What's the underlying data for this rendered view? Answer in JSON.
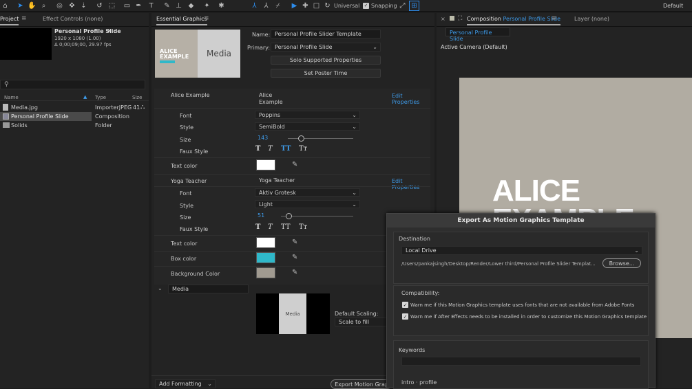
{
  "toolbar": {
    "universal": "Universal",
    "snapping": "Snapping",
    "workspace": "Default"
  },
  "project": {
    "tab_project": "Project",
    "tab_effects": "Effect Controls (none)",
    "preview_title": "Personal Profile Slide",
    "preview_dims": "1920 x 1080 (1.00)",
    "preview_fps": "Δ 0;00;09;00, 29.97 fps",
    "col_name": "Name",
    "col_type": "Type",
    "col_size": "Size",
    "items": [
      {
        "name": "Media.jpg",
        "type": "ImporterJPEG",
        "size": "41"
      },
      {
        "name": "Personal Profile Slide",
        "type": "Composition",
        "size": ""
      },
      {
        "name": "Solids",
        "type": "Folder",
        "size": ""
      }
    ]
  },
  "eg": {
    "tab": "Essential Graphics",
    "thumb_line1": "ALICE",
    "thumb_line2": "EXAMPLE",
    "thumb_media": "Media",
    "name_label": "Name:",
    "name_value": "Personal Profile Slider Template",
    "primary_label": "Primary:",
    "primary_value": "Personal Profile Slide",
    "solo_btn": "Solo Supported Properties",
    "poster_btn": "Set Poster Time",
    "edit_props": "Edit Properties",
    "group1": {
      "title": "Alice Example",
      "value_l1": "Alice",
      "value_l2": "Example",
      "font_label": "Font",
      "font": "Poppins",
      "style_label": "Style",
      "style": "SemiBold",
      "size_label": "Size",
      "size": "143",
      "size_fraction": 0.2,
      "faux_label": "Faux Style",
      "textcolor_label": "Text color",
      "text_color": "#ffffff"
    },
    "group2": {
      "title": "Yoga Teacher",
      "value": "Yoga Teacher",
      "font_label": "Font",
      "font": "Aktiv Grotesk",
      "style_label": "Style",
      "style": "Light",
      "size_label": "Size",
      "size": "51",
      "size_fraction": 0.1,
      "faux_label": "Faux Style",
      "textcolor_label": "Text color",
      "text_color": "#ffffff",
      "boxcolor_label": "Box color",
      "box_color": "#2fb8c9",
      "bgcolor_label": "Background Color",
      "bg_color": "#a09a90"
    },
    "media_label": "Media",
    "media_thumb": "Media",
    "default_scaling_label": "Default Scaling:",
    "default_scaling": "Scale to fill",
    "add_formatting": "Add Formatting",
    "export_btn": "Export Motion Grap"
  },
  "comp": {
    "tab_prefix": "Composition",
    "tab_name": "Personal Profile Slide",
    "layer_tab": "Layer (none)",
    "subtab": "Personal Profile Slide",
    "camera": "Active Camera (Default)",
    "title_l1": "ALICE",
    "title_l2": "EXAMPLE"
  },
  "dialog": {
    "title": "Export As Motion Graphics Template",
    "destination_label": "Destination",
    "destination": "Local Drive",
    "path": "/Users/pankajsingh/Desktop/Render/Lower third/Personal Profile Slider Templat...",
    "browse": "Browse...",
    "compat_label": "Compatibility:",
    "warn1": "Warn me if this Motion Graphics template uses fonts that are not available from Adobe Fonts",
    "warn2": "Warn me if After Effects needs to be installed in order to customize this Motion Graphics template",
    "keywords_label": "Keywords",
    "tags": "intro · profile"
  }
}
